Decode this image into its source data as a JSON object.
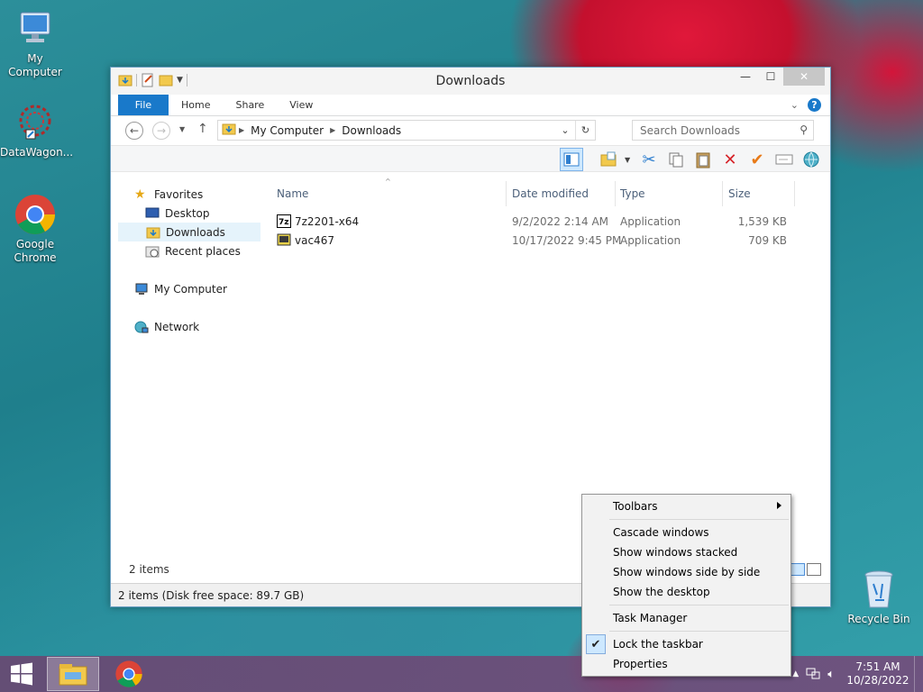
{
  "desktop": {
    "icons": [
      {
        "label": "My Computer"
      },
      {
        "label": "DataWagon..."
      },
      {
        "label": "Google Chrome"
      },
      {
        "label": "Recycle Bin"
      }
    ]
  },
  "window": {
    "title": "Downloads",
    "tabs": {
      "file": "File",
      "home": "Home",
      "share": "Share",
      "view": "View"
    },
    "help_glyph": "?",
    "address": {
      "crumbs": [
        "My Computer",
        "Downloads"
      ]
    },
    "search": {
      "placeholder": "Search Downloads"
    },
    "nav": {
      "favorites": "Favorites",
      "desktop": "Desktop",
      "downloads": "Downloads",
      "recent": "Recent places",
      "computer": "My Computer",
      "network": "Network"
    },
    "columns": {
      "name": "Name",
      "date": "Date modified",
      "type": "Type",
      "size": "Size"
    },
    "files": [
      {
        "name": "7z2201-x64",
        "date": "9/2/2022 2:14 AM",
        "type": "Application",
        "size": "1,539 KB"
      },
      {
        "name": "vac467",
        "date": "10/17/2022 9:45 PM",
        "type": "Application",
        "size": "709 KB"
      }
    ],
    "items_count": "2 items",
    "status": "2 items (Disk free space: 89.7 GB)"
  },
  "context_menu": {
    "toolbars": "Toolbars",
    "cascade": "Cascade windows",
    "stacked": "Show windows stacked",
    "side_by_side": "Show windows side by side",
    "show_desktop": "Show the desktop",
    "task_manager": "Task Manager",
    "lock_taskbar": "Lock the taskbar",
    "properties": "Properties"
  },
  "taskbar": {
    "time": "7:51 AM",
    "date": "10/28/2022"
  },
  "colors": {
    "accent": "#1979ca",
    "selection": "#cde8ff"
  }
}
